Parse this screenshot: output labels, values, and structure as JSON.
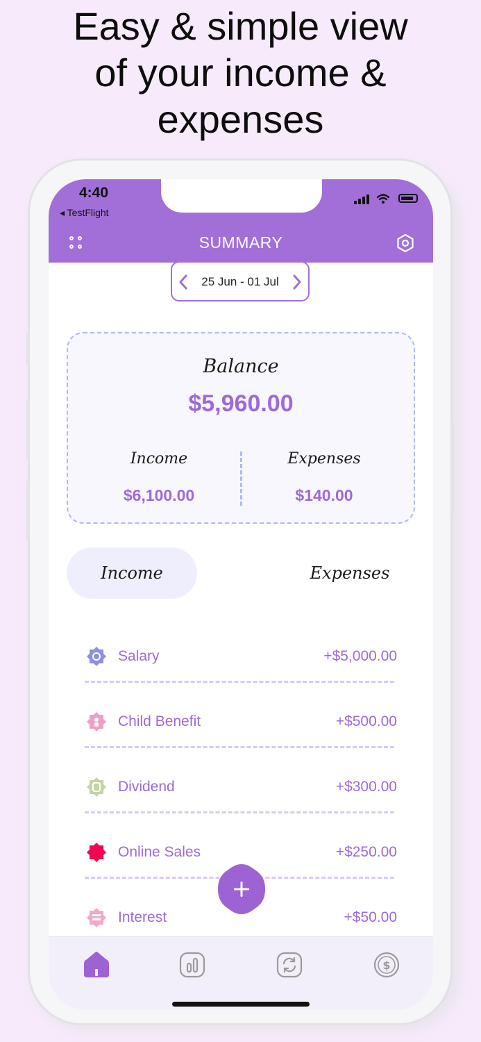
{
  "headline": [
    "Easy & simple view",
    "of your income &",
    "expenses"
  ],
  "status_bar": {
    "time": "4:40",
    "back_app": "◂ TestFlight"
  },
  "header": {
    "title": "SUMMARY",
    "menu_icon": "grid-dots-icon",
    "settings_icon": "settings-hexagon-icon"
  },
  "date_range": {
    "label": "25 Jun - 01 Jul"
  },
  "balance_card": {
    "balance_label": "Balance",
    "balance_value": "$5,960.00",
    "income_label": "Income",
    "income_value": "$6,100.00",
    "expenses_label": "Expenses",
    "expenses_value": "$140.00"
  },
  "tabs": {
    "income": "Income",
    "expenses": "Expenses",
    "active": "income"
  },
  "transactions": [
    {
      "name": "Salary",
      "amount": "+$5,000.00",
      "icon_color": "#8d8fe0",
      "icon": "salary-icon"
    },
    {
      "name": "Child Benefit",
      "amount": "+$500.00",
      "icon_color": "#ee9fc8",
      "icon": "child-benefit-icon"
    },
    {
      "name": "Dividend",
      "amount": "+$300.00",
      "icon_color": "#c4d4a4",
      "icon": "dividend-icon"
    },
    {
      "name": "Online Sales",
      "amount": "+$250.00",
      "icon_color": "#f2064f",
      "icon": "online-sales-icon"
    },
    {
      "name": "Interest",
      "amount": "+$50.00",
      "icon_color": "#f4a8c6",
      "icon": "interest-icon"
    }
  ],
  "fab": {
    "icon": "plus-icon"
  },
  "bottom_nav": [
    "home-icon",
    "chart-icon",
    "sync-icon",
    "currency-icon"
  ],
  "colors": {
    "accent": "#a26fd8",
    "background": "#f7ebfb",
    "card_border": "#aebaee"
  }
}
